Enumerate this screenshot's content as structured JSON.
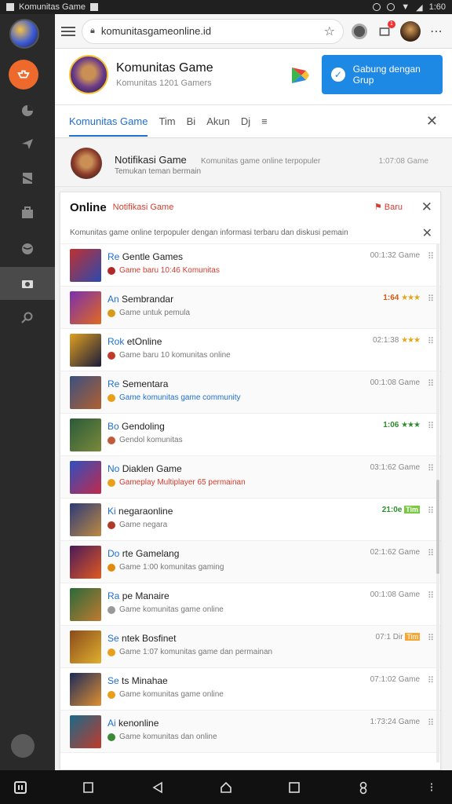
{
  "status_bar": {
    "app_title": "Komunitas Game",
    "time": "1:60"
  },
  "browser": {
    "url": "komunitasgameonline.id",
    "badge_count": "1"
  },
  "profile": {
    "name": "Komunitas Game",
    "subtitle": "Komunitas 1201 Gamers",
    "button_label": "Gabung dengan Grup"
  },
  "tabs": [
    {
      "label": "Komunitas Game"
    },
    {
      "label": "Tim"
    },
    {
      "label": "Bi"
    },
    {
      "label": "Akun"
    },
    {
      "label": "Dj"
    }
  ],
  "notification": {
    "title": "Notifikasi Game",
    "middle": "Komunitas game online terpopuler",
    "subtitle": "Temukan teman bermain",
    "time": "1:07:08 Game"
  },
  "panel": {
    "title": "Online",
    "subtitle": "Notifikasi Game",
    "badge": "Baru",
    "description": "Komunitas game online terpopuler dengan informasi terbaru dan diskusi pemain"
  },
  "list": [
    {
      "prefix": "Re",
      "title": "Gentle Games",
      "subtitle": "Game baru 10:46 Komunitas",
      "sub_style": "red",
      "meta": "00:1:32 Game",
      "meta_style": "",
      "dot": "#b02a2a",
      "thumb": [
        "#c03030",
        "#2b4ab0"
      ]
    },
    {
      "prefix": "An",
      "title": "Sembrandar",
      "subtitle": "Game untuk pemula",
      "sub_style": "",
      "meta": "1:64",
      "meta_style": "orange",
      "stars": "★★★",
      "dot": "#d89a1a",
      "thumb": [
        "#7a2fb0",
        "#e06a20"
      ]
    },
    {
      "prefix": "Rok",
      "title": "etOnline",
      "subtitle": "Game baru 10 komunitas online",
      "sub_style": "",
      "meta": "02:1:38",
      "meta_style": "",
      "stars": "★★★",
      "dot": "#c23a2a",
      "thumb": [
        "#e0a020",
        "#1a1a3a"
      ]
    },
    {
      "prefix": "Re",
      "title": "Sementara",
      "subtitle": "Game komunitas game community",
      "sub_style": "blue",
      "meta": "00:1:08 Game",
      "meta_style": "",
      "dot": "#e8a01c",
      "thumb": [
        "#3a5080",
        "#b06030"
      ]
    },
    {
      "prefix": "Bo",
      "title": "Gendoling",
      "subtitle": "Gendol komunitas",
      "sub_style": "",
      "meta": "1:06",
      "meta_style": "green",
      "stars": "★★★",
      "stars_style": "green",
      "dot": "#c05a3a",
      "thumb": [
        "#2a5a3a",
        "#7a8a3a"
      ]
    },
    {
      "prefix": "No",
      "title": "Diaklen Game",
      "subtitle": "Gameplay Multiplayer 65 permainan",
      "sub_style": "red",
      "meta": "03:1:62 Game",
      "meta_style": "",
      "dot": "#e8a01c",
      "thumb": [
        "#3050c0",
        "#c02a4a"
      ]
    },
    {
      "prefix": "Ki",
      "title": "negaraonline",
      "subtitle": "Game negara",
      "sub_style": "",
      "meta": "21:0e",
      "meta_style": "green",
      "tag": "Tim",
      "tag_style": "",
      "dot": "#b03a2a",
      "thumb": [
        "#2a3a7a",
        "#c08a40"
      ]
    },
    {
      "prefix": "Do",
      "title": "rte Gamelang",
      "subtitle": "Game 1:00 komunitas gaming",
      "sub_style": "",
      "meta": "02:1:62 Game",
      "meta_style": "",
      "dot": "#e08a10",
      "thumb": [
        "#4a1a5a",
        "#e05a20"
      ]
    },
    {
      "prefix": "Ra",
      "title": "pe Manaire",
      "subtitle": "Game komunitas game online",
      "sub_style": "",
      "meta": "00:1:08 Game",
      "meta_style": "",
      "dot": "#999999",
      "thumb": [
        "#2a6a3a",
        "#c07a30"
      ]
    },
    {
      "prefix": "Se",
      "title": "ntek Bosfinet",
      "subtitle": "Game 1:07 komunitas game dan permainan",
      "sub_style": "",
      "meta": "07:1 Dir",
      "meta_style": "",
      "tag": "Tim",
      "tag_style": "orange",
      "dot": "#e8a01c",
      "thumb": [
        "#8a4a1a",
        "#e0b030"
      ]
    },
    {
      "prefix": "Se",
      "title": "ts Minahae",
      "subtitle": "Game komunitas game online",
      "sub_style": "",
      "meta": "07:1:02 Game",
      "meta_style": "",
      "dot": "#e8a01c",
      "thumb": [
        "#1a2a5a",
        "#e09030"
      ]
    },
    {
      "prefix": "Ai",
      "title": "kenonline",
      "subtitle": "Game komunitas dan online",
      "sub_style": "",
      "meta": "1:73:24 Game",
      "meta_style": "",
      "dot": "#3a8a3a",
      "thumb": [
        "#1a6a8a",
        "#c03a2a"
      ]
    }
  ]
}
